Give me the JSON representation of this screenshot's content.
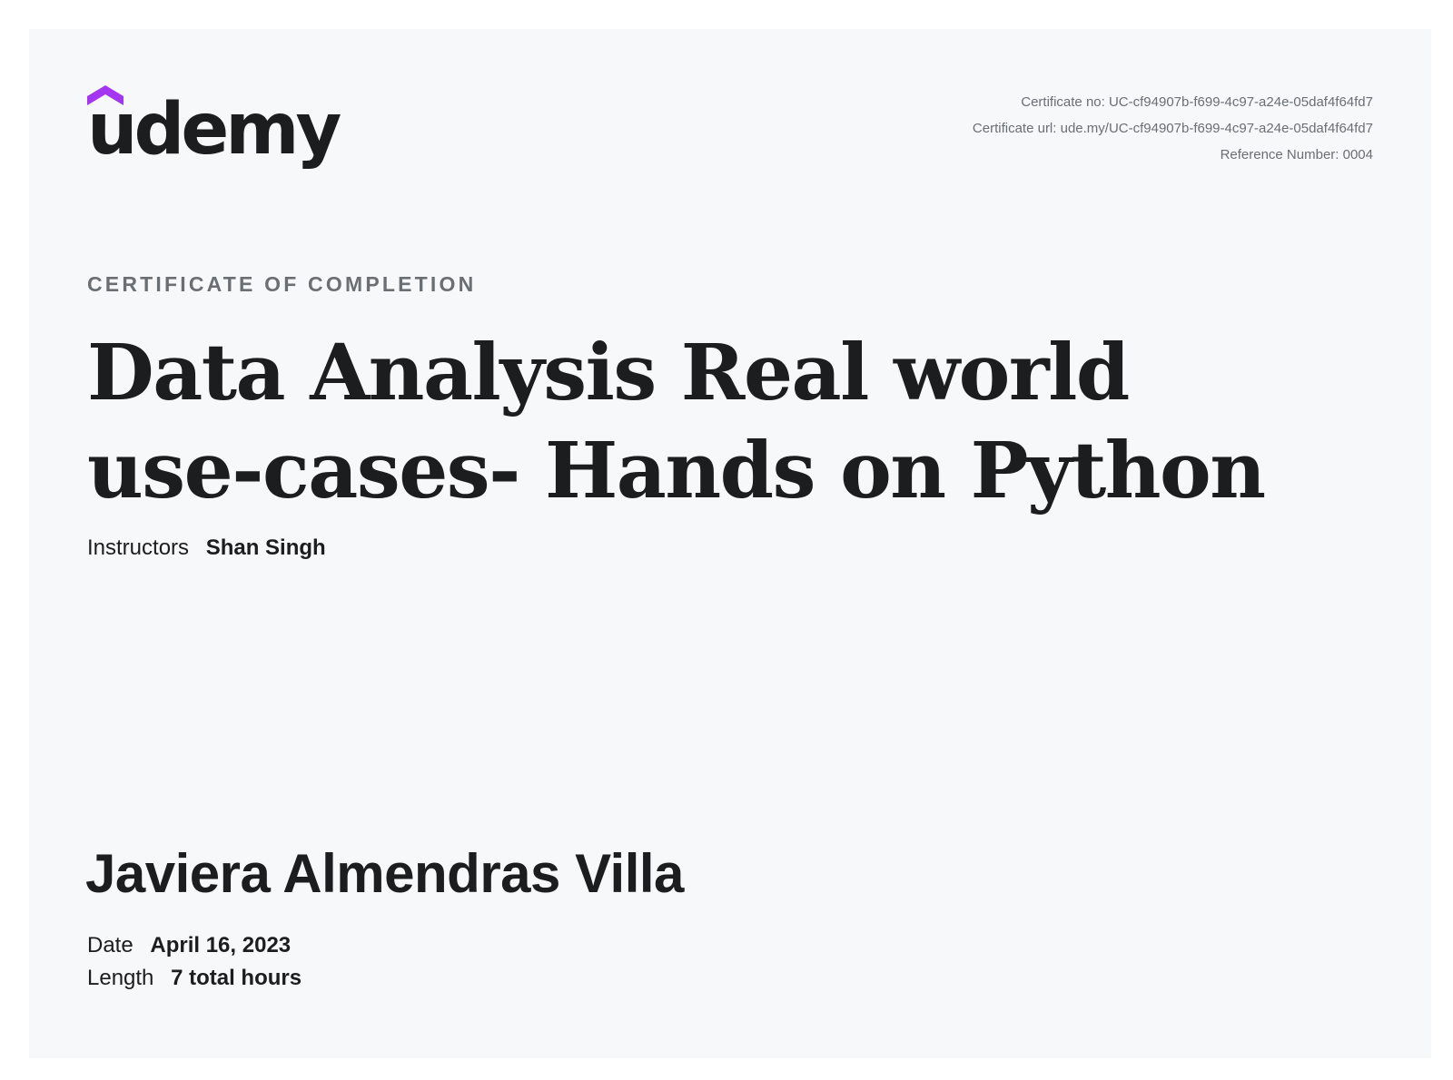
{
  "brand": {
    "name": "udemy",
    "accent_color": "#a435f0"
  },
  "certificate_meta": {
    "certificate_no": "Certificate no: UC-cf94907b-f699-4c97-a24e-05daf4f64fd7",
    "certificate_url": "Certificate url: ude.my/UC-cf94907b-f699-4c97-a24e-05daf4f64fd7",
    "reference_number": "Reference Number: 0004"
  },
  "heading": "CERTIFICATE OF COMPLETION",
  "course_title": "Data Analysis Real world use-cases- Hands on Python",
  "instructors": {
    "label": "Instructors",
    "value": "Shan Singh"
  },
  "recipient_name": "Javiera Almendras Villa",
  "details": {
    "date_label": "Date",
    "date_value": "April 16, 2023",
    "length_label": "Length",
    "length_value": "7 total hours"
  }
}
